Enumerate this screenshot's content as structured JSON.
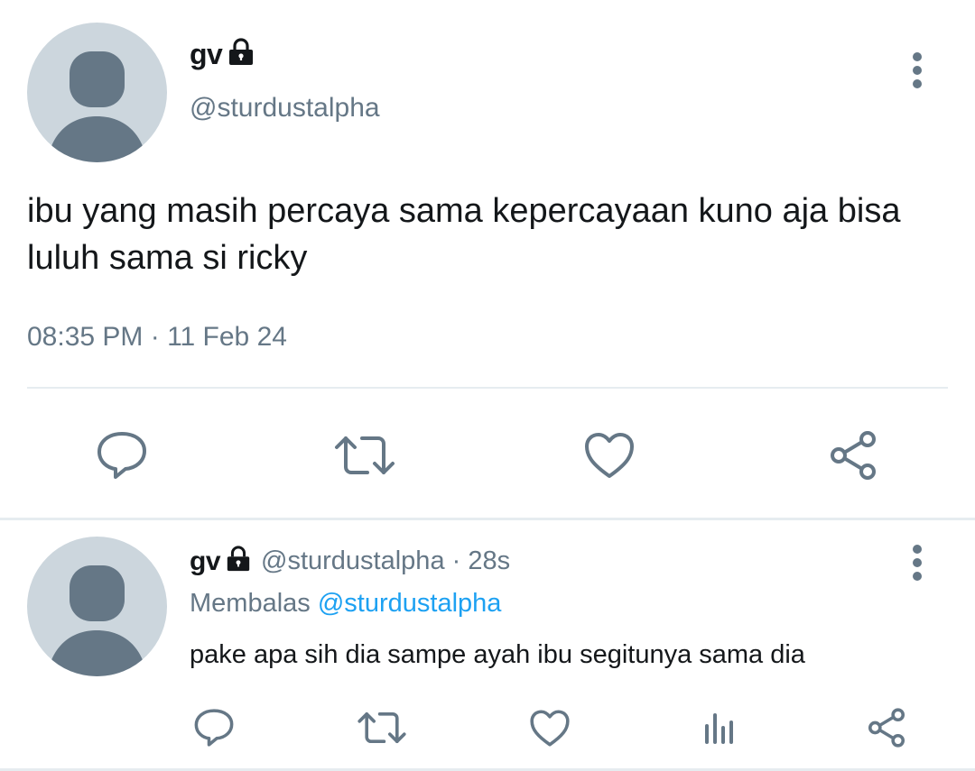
{
  "colors": {
    "primary_text": "#14171a",
    "secondary_text": "#657786",
    "accent_link": "#1da1f2",
    "avatar_bg": "#ccd6dd",
    "avatar_fg": "#657786",
    "divider": "#e6ecf0"
  },
  "main_tweet": {
    "display_name": "gv",
    "handle": "@sturdustalpha",
    "text": "ibu yang masih percaya sama kepercayaan kuno aja bisa luluh sama si ricky",
    "timestamp": "08:35 PM · 11 Feb 24",
    "icons": {
      "protected": "lock-icon",
      "more": "more-vertical-icon",
      "reply": "reply-icon",
      "retweet": "retweet-icon",
      "like": "heart-icon",
      "share": "share-icon"
    }
  },
  "reply_tweet": {
    "display_name": "gv",
    "meta": "@sturdustalpha · 28s",
    "replying_prefix": "Membalas",
    "replying_to": "@sturdustalpha",
    "text": "pake apa sih dia sampe ayah ibu segitunya sama dia",
    "icons": {
      "protected": "lock-icon",
      "more": "more-vertical-icon",
      "reply": "reply-icon",
      "retweet": "retweet-icon",
      "like": "heart-icon",
      "stats": "analytics-icon",
      "share": "share-icon"
    }
  }
}
